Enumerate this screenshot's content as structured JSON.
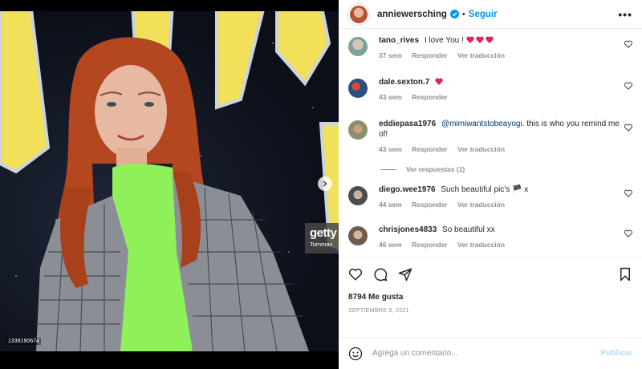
{
  "header": {
    "username": "anniewersching",
    "separator": "•",
    "follow_label": "Seguir",
    "more_label": "•••"
  },
  "media": {
    "watermark_brand": "getty",
    "watermark_credit": "Tommas",
    "image_number": "1339190674"
  },
  "comments": [
    {
      "user": "tano_rives",
      "text": "I love You !",
      "hearts": 3,
      "age": "37 sem",
      "reply": "Responder",
      "translate": "Ver traducción",
      "avatar_color": "#7aa39a"
    },
    {
      "user": "dale.sexton.7",
      "text": "",
      "hearts": 1,
      "age": "43 sem",
      "reply": "Responder",
      "translate": "",
      "avatar_color": "#2b4f7e"
    },
    {
      "user": "eddiepasa1976",
      "mention": "@mimiwantstobeayogi",
      "text": ". this is who you remind me of!",
      "hearts": 0,
      "age": "43 sem",
      "reply": "Responder",
      "translate": "Ver traducción",
      "avatar_color": "#8a8f6e"
    },
    {
      "user": "diego.wee1976",
      "text": "Such beautiful pic's 🏴 x",
      "hearts": 0,
      "age": "44 sem",
      "reply": "Responder",
      "translate": "Ver traducción",
      "avatar_color": "#4d4d4d"
    },
    {
      "user": "chrisjones4833",
      "text": "So beautiful xx",
      "hearts": 0,
      "age": "46 sem",
      "reply": "Responder",
      "translate": "Ver traducción",
      "avatar_color": "#6e5b4e"
    }
  ],
  "view_replies": "Ver respuestas (1)",
  "actions": {
    "likes": "8794 Me gusta",
    "date": "SEPTIEMBRE 9, 2021"
  },
  "composer": {
    "placeholder": "Agrega un comentario...",
    "publish_label": "Publicar"
  },
  "colors": {
    "accent": "#0095f6",
    "heart": "#ed4956",
    "publish_disabled": "#b2dffc",
    "muted": "#8e8e8e"
  },
  "icons": [
    "verified-badge-icon",
    "more-options-icon",
    "heart-icon",
    "comment-icon",
    "share-icon",
    "bookmark-icon",
    "emoji-icon",
    "chevron-right-icon"
  ]
}
